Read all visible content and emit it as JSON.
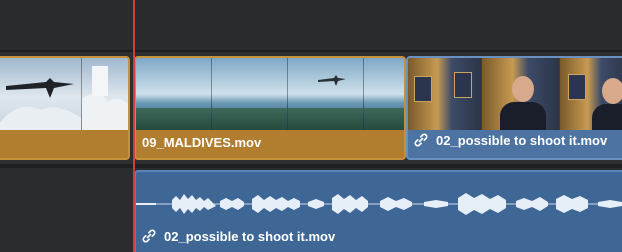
{
  "timeline": {
    "clips": {
      "video_left": {
        "kind": "video",
        "color": "#b07e2e"
      },
      "maldives": {
        "label": "09_MALDIVES.mov",
        "color": "#b07e2e"
      },
      "possible_video": {
        "label": "02_possible to shoot it.mov",
        "linked": true,
        "color": "#4d73a3"
      },
      "possible_audio": {
        "label": "02_possible to shoot it.mov",
        "linked": true,
        "color": "#3f6796"
      }
    },
    "playhead_color": "#d13c3c",
    "icons": {
      "link": "link-icon"
    }
  }
}
